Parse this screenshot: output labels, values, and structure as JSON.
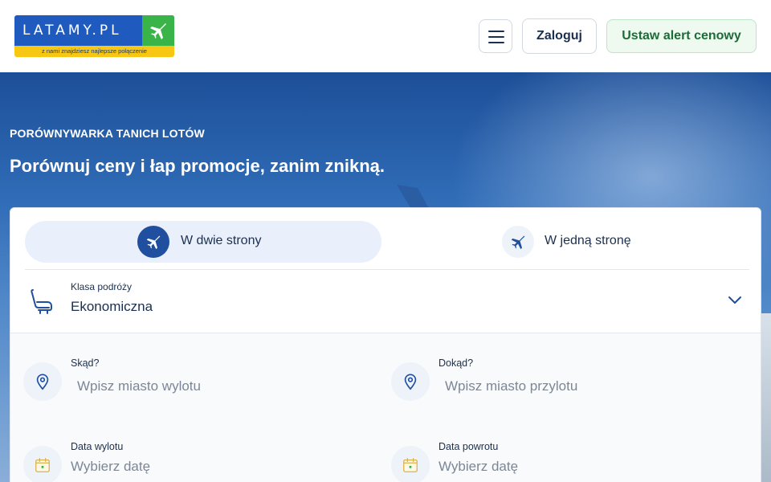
{
  "header": {
    "logo_text": "LATAMY.PL",
    "logo_tagline": "z nami znajdziesz najlepsze połączenie",
    "login_label": "Zaloguj",
    "alert_label": "Ustaw alert cenowy"
  },
  "hero": {
    "subtitle": "PORÓWNYWARKA TANICH LOTÓW",
    "title": "Porównuj ceny i łap promocje, zanim znikną."
  },
  "search": {
    "tabs": [
      {
        "label": "W dwie strony",
        "active": true
      },
      {
        "label": "W jedną stronę",
        "active": false
      }
    ],
    "travel_class": {
      "label": "Klasa podróży",
      "value": "Ekonomiczna"
    },
    "from": {
      "label": "Skąd?",
      "placeholder": "Wpisz miasto wylotu"
    },
    "to": {
      "label": "Dokąd?",
      "placeholder": "Wpisz miasto przylotu"
    },
    "departure": {
      "label": "Data wylotu",
      "placeholder": "Wybierz datę"
    },
    "return": {
      "label": "Data powrotu",
      "placeholder": "Wybierz datę"
    }
  },
  "colors": {
    "brand_blue": "#1f5bbf",
    "brand_green": "#38b449",
    "brand_yellow": "#f7c713",
    "text_dark": "#1b2f4e"
  }
}
